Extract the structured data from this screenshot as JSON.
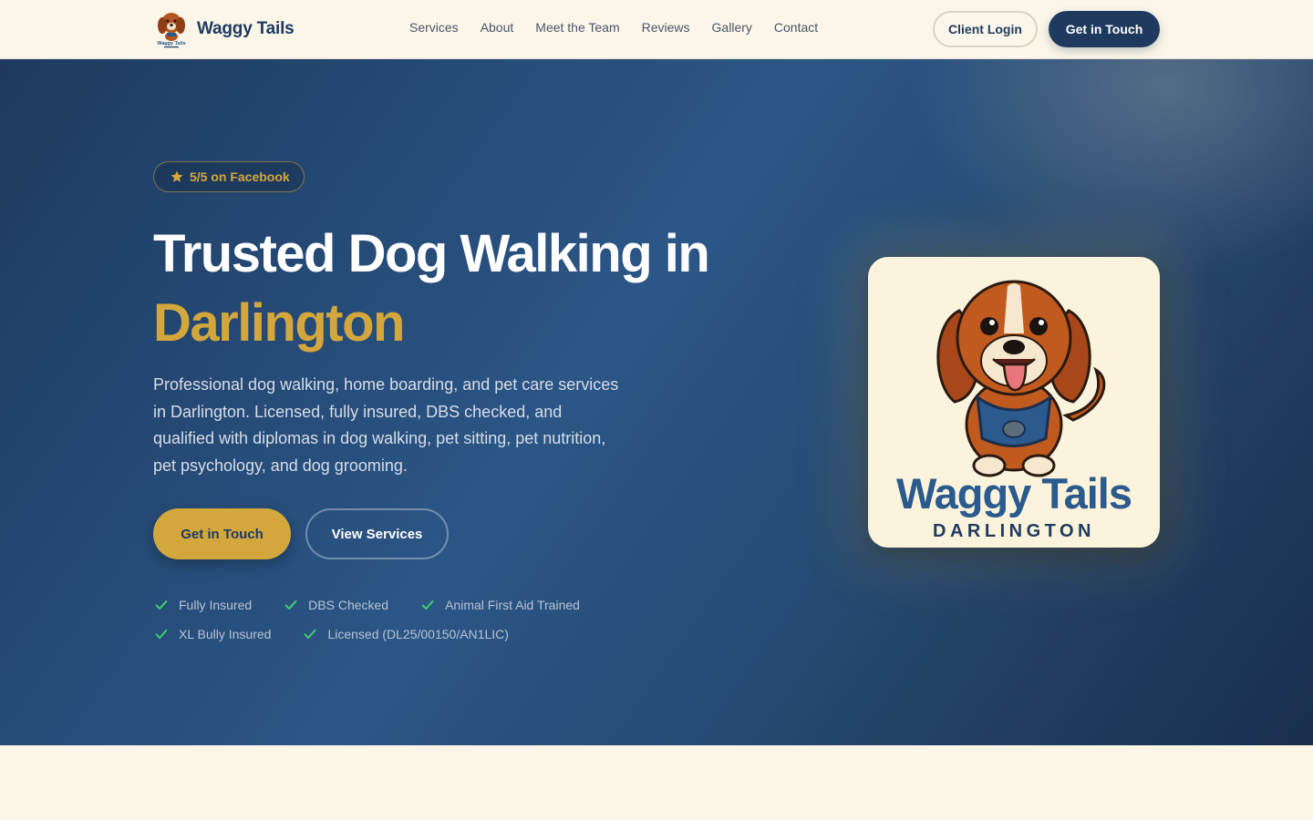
{
  "brand": {
    "name": "Waggy Tails",
    "logo_icon": "dog-logo-icon"
  },
  "nav": {
    "links": [
      "Services",
      "About",
      "Meet the Team",
      "Reviews",
      "Gallery",
      "Contact"
    ],
    "login_label": "Client Login",
    "cta_label": "Get in Touch"
  },
  "hero": {
    "rating": {
      "icon": "star-icon",
      "text": "5/5 on Facebook"
    },
    "headline_line1": "Trusted Dog Walking in",
    "headline_highlight": "Darlington",
    "description": "Professional dog walking, home boarding, and pet care services in Darlington. Licensed, fully insured, DBS checked, and qualified with diplomas in dog walking, pet sitting, pet nutrition, pet psychology, and dog grooming.",
    "primary_button": "Get in Touch",
    "secondary_button": "View Services",
    "trust_items": [
      "Fully Insured",
      "DBS Checked",
      "Animal First Aid Trained",
      "XL Bully Insured",
      "Licensed (DL25/00150/AN1LIC)"
    ]
  },
  "logo_card": {
    "brand": "Waggy Tails",
    "city": "DARLINGTON"
  },
  "colors": {
    "navy": "#1e3a5f",
    "gold": "#d4a73c",
    "cream": "#fbf6e9",
    "check_green": "#3ecf6e"
  }
}
